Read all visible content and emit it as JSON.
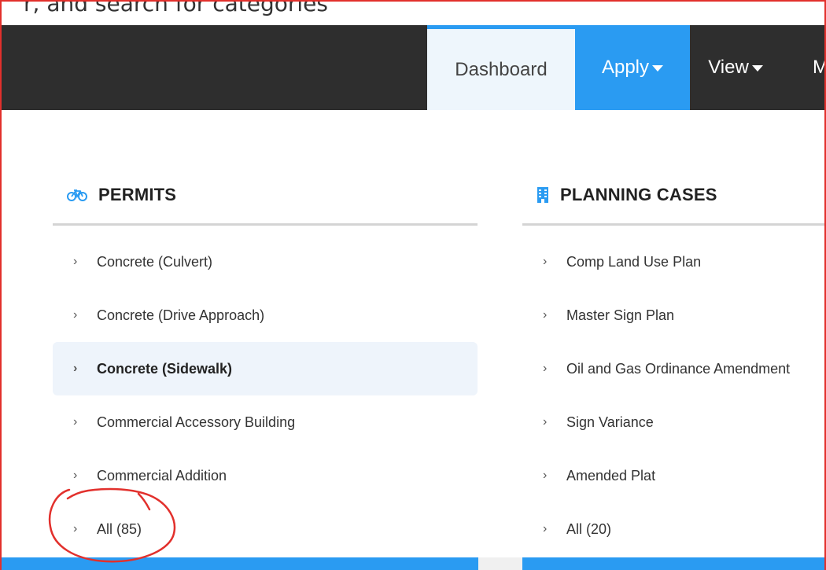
{
  "top_strip": {
    "partial_text": "r, and search for categories"
  },
  "nav": {
    "dashboard": "Dashboard",
    "apply": "Apply",
    "view": "View",
    "more": "M"
  },
  "permits": {
    "title": "PERMITS",
    "icon": "bicycle-icon",
    "items": [
      {
        "label": "Concrete (Culvert)"
      },
      {
        "label": "Concrete (Drive Approach)"
      },
      {
        "label": "Concrete (Sidewalk)",
        "active": true
      },
      {
        "label": "Commercial Accessory Building"
      },
      {
        "label": "Commercial Addition"
      },
      {
        "label": "All (85)"
      }
    ]
  },
  "planning": {
    "title": "PLANNING CASES",
    "icon": "building-icon",
    "items": [
      {
        "label": "Comp Land Use Plan"
      },
      {
        "label": "Master Sign Plan"
      },
      {
        "label": "Oil and Gas Ordinance Amendment"
      },
      {
        "label": "Sign Variance"
      },
      {
        "label": "Amended Plat"
      },
      {
        "label": "All (20)"
      }
    ]
  },
  "chevron": "›",
  "colors": {
    "accent": "#2a9bf2",
    "navbar": "#2e2e2e",
    "annotation": "#e2302c"
  }
}
